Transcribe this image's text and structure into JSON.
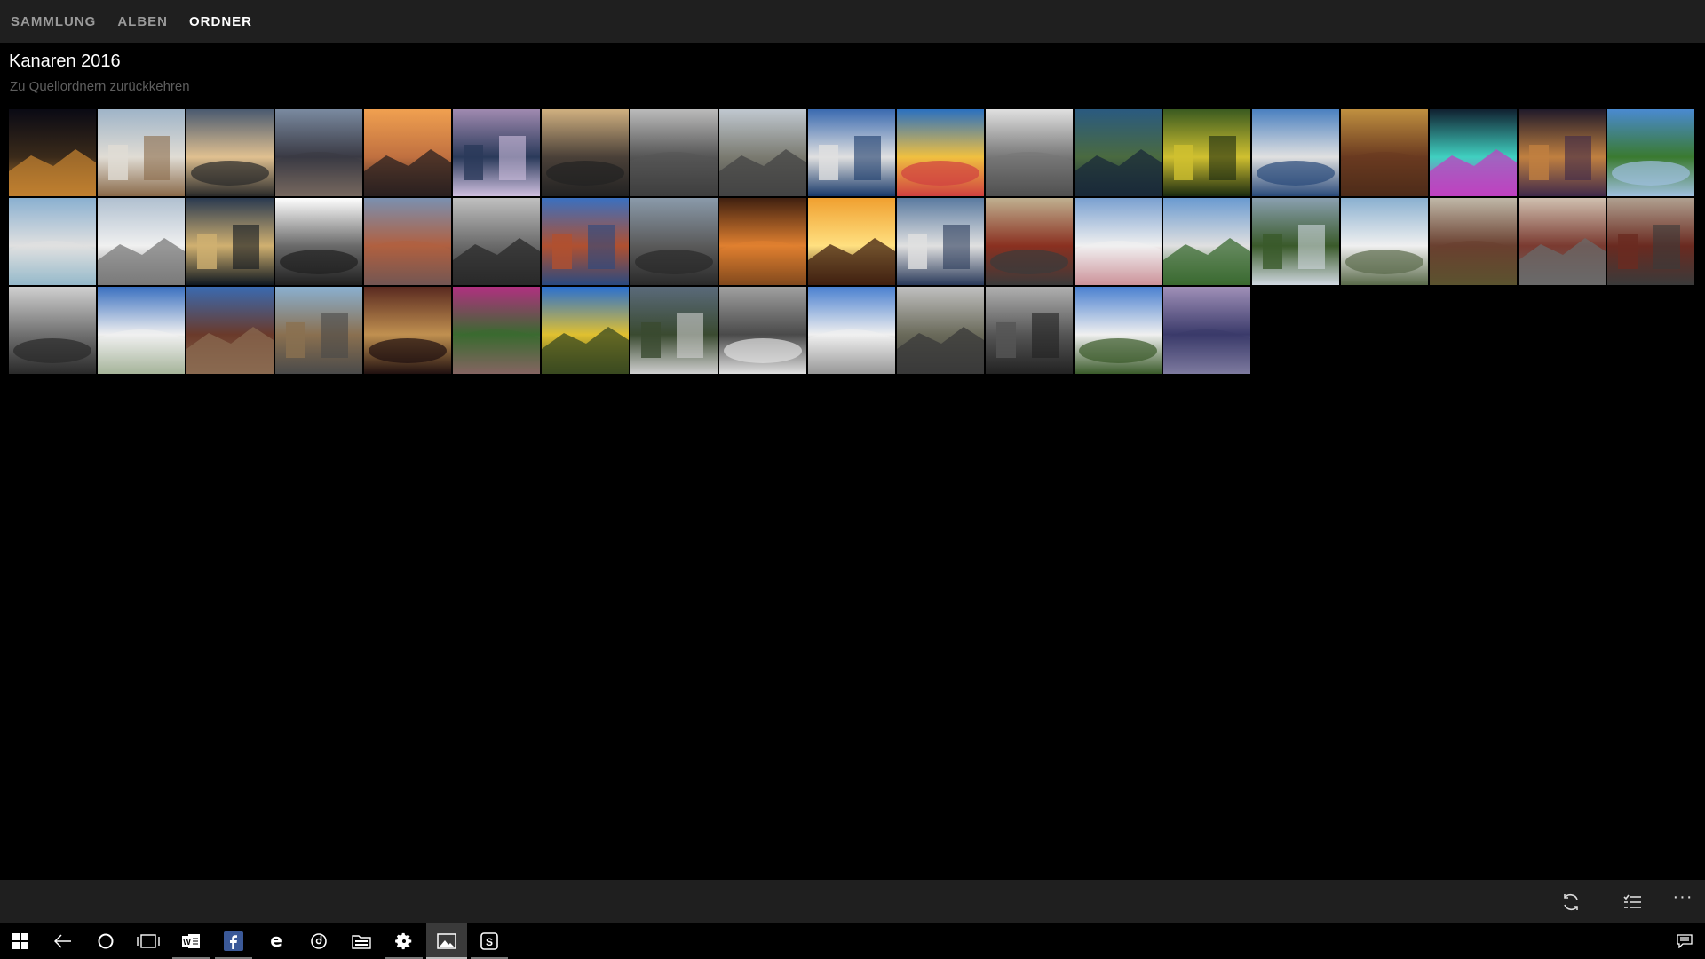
{
  "nav": {
    "items": [
      {
        "label": "SAMMLUNG",
        "active": false
      },
      {
        "label": "ALBEN",
        "active": false
      },
      {
        "label": "ORDNER",
        "active": true
      }
    ]
  },
  "folder": {
    "title": "Kanaren 2016",
    "back_link": "Zu Quellordnern zurückkehren"
  },
  "photos": [
    {
      "scene": "night-harbor-ship",
      "colors": [
        "#0a0a14",
        "#3a2a1a",
        "#c08030"
      ]
    },
    {
      "scene": "white-town-coast",
      "colors": [
        "#9fb4c8",
        "#e0dcd4",
        "#8a6a4a"
      ]
    },
    {
      "scene": "beach-sunset-clouds",
      "colors": [
        "#4a5a70",
        "#e0c090",
        "#2a2a2a"
      ]
    },
    {
      "scene": "volcano-silhouette-dusk",
      "colors": [
        "#7a8aa0",
        "#3a3a44",
        "#c0a080"
      ]
    },
    {
      "scene": "orange-sky-mountain",
      "colors": [
        "#f0a050",
        "#c07040",
        "#2a2020"
      ]
    },
    {
      "scene": "blue-mountains-purple-sky",
      "colors": [
        "#a08ab0",
        "#2a3a5a",
        "#d0c0e0"
      ]
    },
    {
      "scene": "crowd-palms-street",
      "colors": [
        "#d0b080",
        "#4a4038",
        "#222"
      ]
    },
    {
      "scene": "crowd-palms-bw",
      "colors": [
        "#bbbbbb",
        "#555555",
        "#222222"
      ]
    },
    {
      "scene": "narrow-street-houses",
      "colors": [
        "#c0c8d0",
        "#7a7a70",
        "#444"
      ]
    },
    {
      "scene": "blue-boats-harbor",
      "colors": [
        "#3a6ab0",
        "#e0e0e0",
        "#1a3a6a"
      ]
    },
    {
      "scene": "colorful-boat-closeup",
      "colors": [
        "#2a70c0",
        "#f0c040",
        "#d04040"
      ]
    },
    {
      "scene": "boat-closeup-bw",
      "colors": [
        "#e0e0e0",
        "#777777",
        "#222222"
      ]
    },
    {
      "scene": "aerial-sea-cliff",
      "colors": [
        "#2a5a80",
        "#4a6a40",
        "#1a2a3a"
      ]
    },
    {
      "scene": "yellow-flowers-green",
      "colors": [
        "#3a5a20",
        "#d0c030",
        "#1a2a10"
      ]
    },
    {
      "scene": "harbor-boats-blue",
      "colors": [
        "#4a80c0",
        "#e0e0e0",
        "#2a4a7a"
      ]
    },
    {
      "scene": "church-interior-gold",
      "colors": [
        "#c09040",
        "#6a3a20",
        "#2a1a10"
      ]
    },
    {
      "scene": "neon-fountain-night",
      "colors": [
        "#102030",
        "#40d0c0",
        "#c040c0"
      ]
    },
    {
      "scene": "city-lights-night",
      "colors": [
        "#201a2a",
        "#c08040",
        "#402a4a"
      ]
    },
    {
      "scene": "green-hills-blue-sky",
      "colors": [
        "#4a8ad0",
        "#3a7a30",
        "#a0c0e0"
      ]
    },
    {
      "scene": "bay-beach-clouds",
      "colors": [
        "#8ab0d0",
        "#e0e0e0",
        "#3a8ab0"
      ]
    },
    {
      "scene": "white-colonial-building",
      "colors": [
        "#b0c0d0",
        "#f0f0f0",
        "#7a7a7a"
      ]
    },
    {
      "scene": "dark-sea-sunset",
      "colors": [
        "#2a3a50",
        "#d0b070",
        "#101820"
      ]
    },
    {
      "scene": "tunnel-bright-light",
      "colors": [
        "#ffffff",
        "#6a6a6a",
        "#202020"
      ]
    },
    {
      "scene": "rusty-ship-wreck",
      "colors": [
        "#7a90b0",
        "#b06040",
        "#2a4a6a"
      ]
    },
    {
      "scene": "ship-wreck-bw",
      "colors": [
        "#c0c0c0",
        "#6a6a6a",
        "#2a2a2a"
      ]
    },
    {
      "scene": "rusty-ship-blue-sky",
      "colors": [
        "#3a70c0",
        "#b05030",
        "#2a4a80"
      ]
    },
    {
      "scene": "ship-wreck-cliff",
      "colors": [
        "#8a9aaa",
        "#5a5a5a",
        "#2a2a2a"
      ]
    },
    {
      "scene": "orange-dark-sunset",
      "colors": [
        "#402010",
        "#e08030",
        "#100808"
      ]
    },
    {
      "scene": "bright-sun-sunset",
      "colors": [
        "#f0a030",
        "#ffe080",
        "#402010"
      ]
    },
    {
      "scene": "marina-boats-town",
      "colors": [
        "#5a7aa0",
        "#e0e0e0",
        "#2a3a5a"
      ]
    },
    {
      "scene": "colorful-street-balconies",
      "colors": [
        "#c0b090",
        "#8a3020",
        "#3a3a3a"
      ]
    },
    {
      "scene": "white-house-red-flowers",
      "colors": [
        "#7aa0d0",
        "#f0f0f0",
        "#a02030"
      ]
    },
    {
      "scene": "coastal-town-view",
      "colors": [
        "#6a9ad0",
        "#e0e0e0",
        "#3a6a30"
      ]
    },
    {
      "scene": "green-valley-clouds",
      "colors": [
        "#8aa0b0",
        "#3a5a2a",
        "#d0d8e0"
      ]
    },
    {
      "scene": "tree-plaza-white-house",
      "colors": [
        "#8ab0d0",
        "#f0f0f0",
        "#5a6a4a"
      ]
    },
    {
      "scene": "house-balcony-plants",
      "colors": [
        "#c0b8a8",
        "#6a4030",
        "#4a6a30"
      ]
    },
    {
      "scene": "balcony-street",
      "colors": [
        "#d0c0b0",
        "#7a3a30",
        "#6a6a6a"
      ]
    },
    {
      "scene": "street-balconies-night",
      "colors": [
        "#b0a090",
        "#6a2a20",
        "#3a3a3a"
      ]
    },
    {
      "scene": "old-street-bw",
      "colors": [
        "#d0d0d0",
        "#707070",
        "#2a2a2a"
      ]
    },
    {
      "scene": "palm-white-houses",
      "colors": [
        "#3a70c0",
        "#f0f0f0",
        "#4a6a30"
      ]
    },
    {
      "scene": "cannon-fortress-sea",
      "colors": [
        "#3a6ab0",
        "#6a3a2a",
        "#8a6a50"
      ]
    },
    {
      "scene": "stone-castle-rooftops",
      "colors": [
        "#8ab0d0",
        "#8a7050",
        "#4a4a4a"
      ]
    },
    {
      "scene": "ornate-interior-red",
      "colors": [
        "#5a2a20",
        "#c09050",
        "#201010"
      ]
    },
    {
      "scene": "purple-bougainvillea",
      "colors": [
        "#b03080",
        "#3a6a30",
        "#e060a0"
      ]
    },
    {
      "scene": "yellow-aloe-blue-sky",
      "colors": [
        "#2a70d0",
        "#e0c030",
        "#3a4a20"
      ]
    },
    {
      "scene": "mountain-town-valley",
      "colors": [
        "#5a6a7a",
        "#3a4a30",
        "#d0d0d0"
      ]
    },
    {
      "scene": "mountain-town-bw",
      "colors": [
        "#a0a0a0",
        "#4a4a4a",
        "#e0e0e0"
      ]
    },
    {
      "scene": "street-lamp-seafront",
      "colors": [
        "#4a80d0",
        "#f0f0f0",
        "#2a2a2a"
      ]
    },
    {
      "scene": "tree-plaza-houses",
      "colors": [
        "#c0c0c0",
        "#6a6a5a",
        "#3a3a3a"
      ]
    },
    {
      "scene": "tree-plaza-bw",
      "colors": [
        "#b0b0b0",
        "#555555",
        "#222222"
      ]
    },
    {
      "scene": "palm-white-house-blue",
      "colors": [
        "#4a80d0",
        "#f0f0f0",
        "#3a5a2a"
      ]
    },
    {
      "scene": "lavender-sea-dusk",
      "colors": [
        "#a090b8",
        "#3a3a6a",
        "#d0c8e0"
      ]
    }
  ],
  "commandbar": {
    "icons": [
      "refresh-icon",
      "select-icon",
      "more-icon"
    ],
    "more_label": "···"
  },
  "taskbar": {
    "icons": [
      "windows-start-icon",
      "back-arrow-icon",
      "cortana-icon",
      "task-view-icon",
      "word-icon",
      "facebook-icon",
      "edge-icon",
      "groove-icon",
      "file-explorer-icon",
      "settings-icon",
      "photos-icon",
      "skype-icon",
      "action-center-icon"
    ]
  }
}
